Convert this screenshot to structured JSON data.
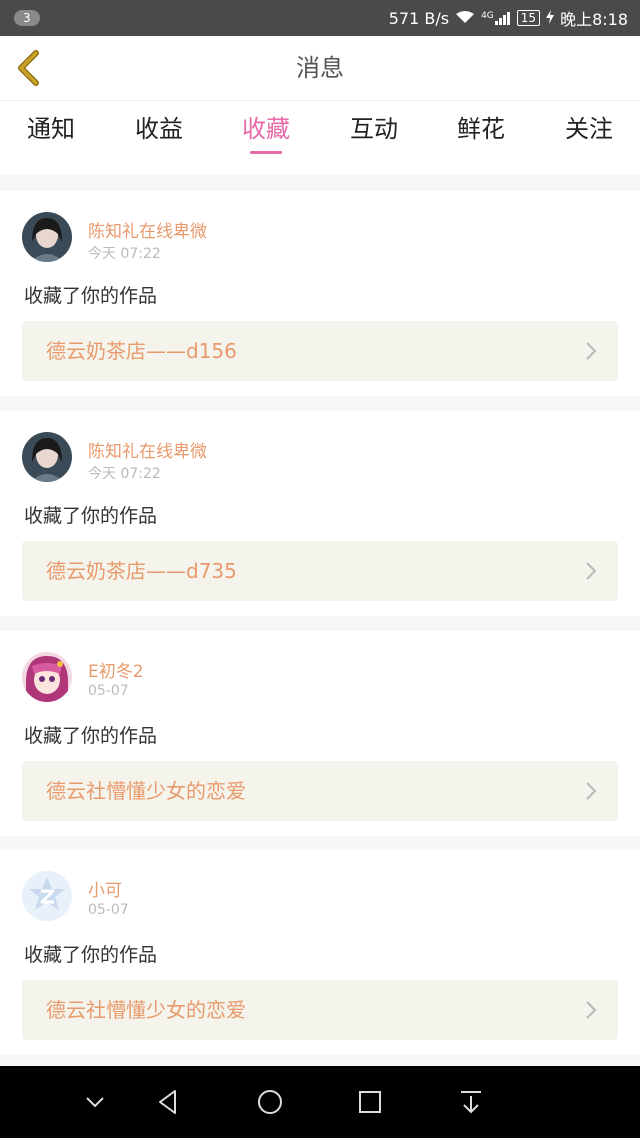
{
  "status_bar": {
    "notification_count": "3",
    "net_speed": "571 B/s",
    "signal_label": "4G",
    "battery": "15",
    "time": "晚上8:18"
  },
  "header": {
    "title": "消息"
  },
  "tabs": [
    {
      "label": "通知",
      "active": false
    },
    {
      "label": "收益",
      "active": false
    },
    {
      "label": "收藏",
      "active": true
    },
    {
      "label": "互动",
      "active": false
    },
    {
      "label": "鲜花",
      "active": false
    },
    {
      "label": "关注",
      "active": false
    }
  ],
  "messages": [
    {
      "user": "陈知礼在线卑微",
      "time": "今天 07:22",
      "action": "收藏了你的作品",
      "work": "德云奶茶店——d156",
      "avatar": "photo-avatar"
    },
    {
      "user": "陈知礼在线卑微",
      "time": "今天 07:22",
      "action": "收藏了你的作品",
      "work": "德云奶茶店——d735",
      "avatar": "photo-avatar"
    },
    {
      "user": "E初冬2",
      "time": "05-07",
      "action": "收藏了你的作品",
      "work": "德云社懵懂少女的恋爱",
      "avatar": "anime-avatar"
    },
    {
      "user": "小可",
      "time": "05-07",
      "action": "收藏了你的作品",
      "work": "德云社懵懂少女的恋爱",
      "avatar": "default-avatar"
    }
  ],
  "colors": {
    "accent_pink": "#e66aa8",
    "name_orange": "#e89a6c",
    "back_arrow": "#c9a227",
    "work_bg": "#f5f4ec"
  },
  "icons": {
    "back": "chevron-left-icon",
    "work_link": "chevron-right-icon",
    "nav": [
      "chevron-down-icon",
      "back-triangle-icon",
      "home-circle-icon",
      "recents-square-icon",
      "pull-down-icon"
    ]
  }
}
